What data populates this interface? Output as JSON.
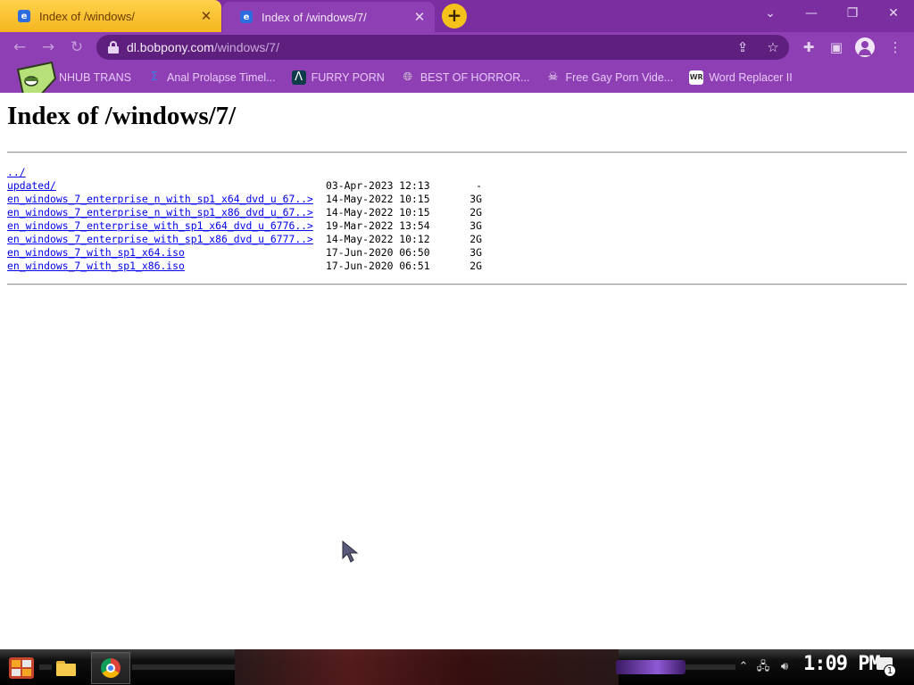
{
  "browser": {
    "tabs": [
      {
        "title": "Index of /windows/",
        "favicon": "ie-page-icon",
        "active": false
      },
      {
        "title": "Index of /windows/7/",
        "favicon": "ie-page-icon",
        "active": true
      }
    ],
    "new_tab_label": "+",
    "address": {
      "host": "dl.bobpony.com",
      "path": "/windows/7/"
    },
    "bookmarks": [
      {
        "label": "NHUB TRANS",
        "icon": "globe-icon"
      },
      {
        "label": "Anal Prolapse Timel...",
        "icon": "sigma-icon"
      },
      {
        "label": "FURRY PORN",
        "icon": "lambda-icon"
      },
      {
        "label": "BEST OF HORROR...",
        "icon": "globe-icon"
      },
      {
        "label": "Free Gay Porn Vide...",
        "icon": "skull-icon"
      },
      {
        "label": "Word Replacer II",
        "icon": "wr-icon"
      }
    ]
  },
  "page": {
    "heading": "Index of /windows/7/",
    "entries": [
      {
        "name": "../",
        "date": "",
        "size": ""
      },
      {
        "name": "updated/",
        "date": "03-Apr-2023 12:13",
        "size": "-"
      },
      {
        "name": "en_windows_7_enterprise_n_with_sp1_x64_dvd_u_67..>",
        "date": "14-May-2022 10:15",
        "size": "3G"
      },
      {
        "name": "en_windows_7_enterprise_n_with_sp1_x86_dvd_u_67..>",
        "date": "14-May-2022 10:15",
        "size": "2G"
      },
      {
        "name": "en_windows_7_enterprise_with_sp1_x64_dvd_u_6776..>",
        "date": "19-Mar-2022 13:54",
        "size": "3G"
      },
      {
        "name": "en_windows_7_enterprise_with_sp1_x86_dvd_u_6777..>",
        "date": "14-May-2022 10:12",
        "size": "2G"
      },
      {
        "name": "en_windows_7_with_sp1_x64.iso",
        "date": "17-Jun-2020 06:50",
        "size": "3G"
      },
      {
        "name": "en_windows_7_with_sp1_x86.iso",
        "date": "17-Jun-2020 06:51",
        "size": "2G"
      }
    ]
  },
  "taskbar": {
    "clock": "1:09 PM",
    "notification_count": "1"
  },
  "colors": {
    "tab_active_bg": "#ffd24a",
    "browser_frame": "#8e3fb3",
    "omnibox_bg": "#5e1f7e",
    "link": "#0000ee",
    "new_tab_button": "#f5c21b"
  }
}
